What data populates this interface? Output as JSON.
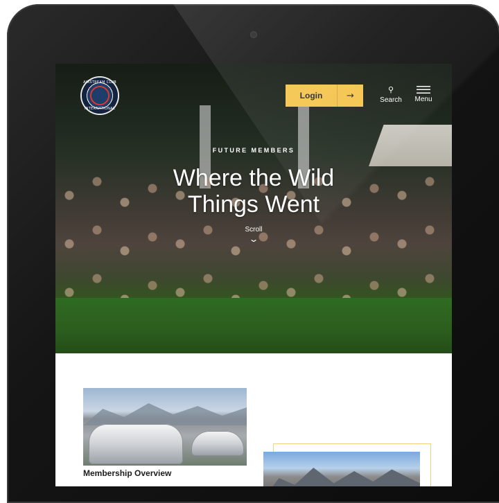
{
  "header": {
    "logo_alt": "Airstream Club International",
    "logo_text_top": "AIRSTREAM CLUB",
    "logo_text_bottom": "INTERNATIONAL",
    "login_label": "Login",
    "login_arrow": "→",
    "search_label": "Search",
    "menu_label": "Menu"
  },
  "hero": {
    "eyebrow": "FUTURE MEMBERS",
    "title_line1": "Where the Wild",
    "title_line2": "Things Went",
    "scroll_label": "Scroll",
    "scroll_icon": "⌄"
  },
  "content": {
    "card1_title": "Membership Overview"
  },
  "colors": {
    "accent": "#f4c44e",
    "card_border": "#f1cf7e"
  }
}
